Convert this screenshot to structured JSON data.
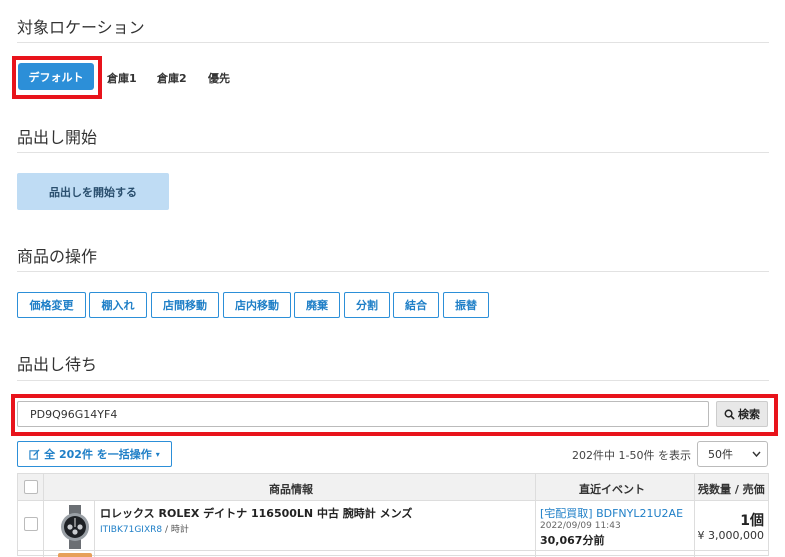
{
  "sections": {
    "location": "対象ロケーション",
    "start": "品出し開始",
    "operations": "商品の操作",
    "waiting": "品出し待ち"
  },
  "locations": {
    "active": "デフォルト",
    "tabs": [
      "倉庫1",
      "倉庫2",
      "優先"
    ]
  },
  "start_button": "品出しを開始する",
  "operations": [
    "価格変更",
    "棚入れ",
    "店間移動",
    "店内移動",
    "廃棄",
    "分割",
    "結合",
    "振替"
  ],
  "search": {
    "value": "PD9Q96G14YF4",
    "button": "検索"
  },
  "bulk_button": "全 202件 を一括操作",
  "pager": {
    "text": "202件中 1-50件 を表示",
    "per_page": "50件"
  },
  "table": {
    "headers": {
      "product": "商品情報",
      "event": "直近イベント",
      "qty": "残数量 / 売価"
    },
    "rows": [
      {
        "name": "ロレックス ROLEX デイトナ 116500LN 中古 腕時計 メンズ",
        "code": "ITIBK71GIXR8",
        "category": "/ 時計",
        "event_title": "[宅配買取] BDFNYL21U2AE",
        "event_date": "2022/09/09 11:43",
        "event_amount": "30,067分前",
        "qty": "1個",
        "price": "¥ 3,000,000"
      }
    ]
  },
  "colors": {
    "primary": "#2c8fd8",
    "highlight": "#e8131b",
    "start_bg": "#bfdcf4"
  }
}
